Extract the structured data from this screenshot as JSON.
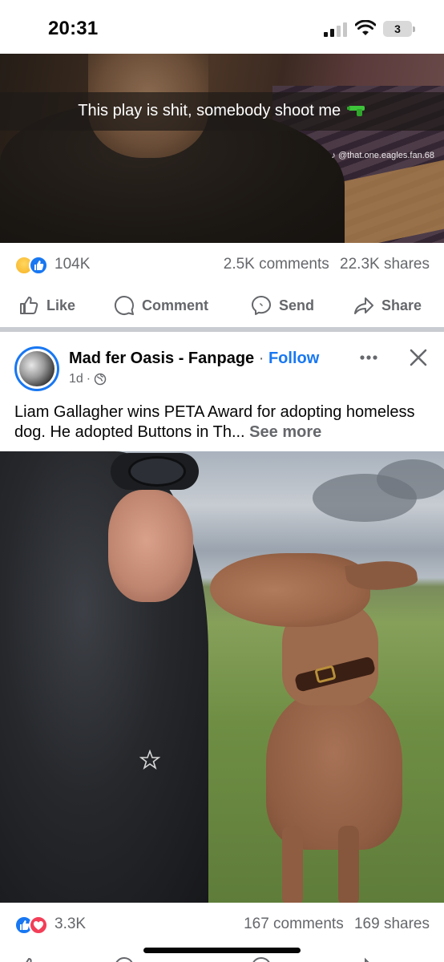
{
  "status_bar": {
    "time": "20:31",
    "battery": "3",
    "icons": [
      "signal-icon",
      "wifi-icon",
      "battery-icon"
    ]
  },
  "post1": {
    "video_caption": "This play is shit, somebody shoot me",
    "caption_emoji": "water-pistol-icon",
    "watermark": "@that.one.eagles.fan.68",
    "reaction_icons": [
      "haha-reaction-icon",
      "like-reaction-icon"
    ],
    "reactions_count": "104K",
    "comments": "2.5K comments",
    "shares": "22.3K shares",
    "actions": {
      "like": "Like",
      "comment": "Comment",
      "send": "Send",
      "share": "Share"
    }
  },
  "post2": {
    "page_name": "Mad fer Oasis - Fanpage",
    "separator": "·",
    "follow": "Follow",
    "time": "1d",
    "meta_separator": "·",
    "audience_icon": "globe-icon",
    "text": "Liam Gallagher wins PETA Award for adopting homeless dog. He adopted Buttons in Th...",
    "see_more": "See more",
    "reaction_icons": [
      "like-reaction-icon",
      "love-reaction-icon"
    ],
    "reactions_count": "3.3K",
    "comments": "167 comments",
    "shares": "169 shares"
  },
  "colors": {
    "facebook_blue": "#1877f2",
    "secondary_text": "#65676b",
    "love_red": "#f33e58",
    "haha_yellow": "#f7b125"
  }
}
